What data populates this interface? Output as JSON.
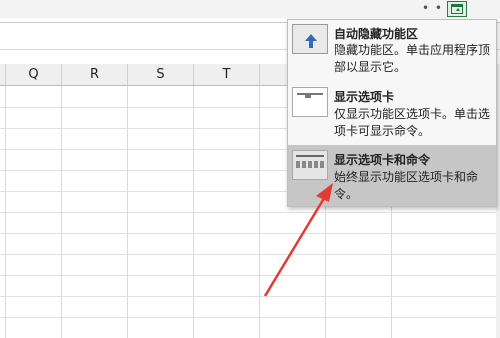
{
  "window": {
    "more_icon": "ellipsis-icon",
    "ribbon_display_icon": "ribbon-display-options-icon",
    "dots": "• • •"
  },
  "sheet": {
    "columns": [
      "",
      "Q",
      "R",
      "S",
      "T",
      "",
      "",
      ""
    ]
  },
  "ribbon_menu": {
    "items": [
      {
        "title": "自动隐藏功能区",
        "description": "隐藏功能区。单击应用程序顶部以显示它。",
        "icon": "auto-hide-ribbon-icon",
        "selected": false
      },
      {
        "title": "显示选项卡",
        "description": "仅显示功能区选项卡。单击选项卡可显示命令。",
        "icon": "show-tabs-icon",
        "selected": false
      },
      {
        "title": "显示选项卡和命令",
        "description": "始终显示功能区选项卡和命令。",
        "icon": "show-tabs-and-commands-icon",
        "selected": true
      }
    ]
  },
  "colors": {
    "selected_item": "#c6c6c6",
    "annotation_arrow": "#e53935",
    "accent": "#217346"
  }
}
